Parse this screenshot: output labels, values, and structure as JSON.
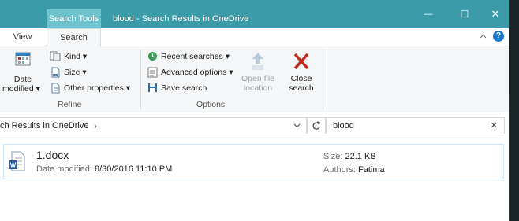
{
  "titlebar": {
    "context_tab": "Search Tools",
    "title": "blood - Search Results in OneDrive",
    "minimize": "—",
    "maximize": "☐",
    "close": "✕"
  },
  "ribbon_tabs": {
    "view": "View",
    "search": "Search"
  },
  "ribbon": {
    "refine": {
      "date_modified_1": "Date",
      "date_modified_2": "modified ▾",
      "kind": "Kind ▾",
      "size": "Size ▾",
      "other_properties": "Other properties ▾",
      "label": "Refine"
    },
    "options": {
      "recent_searches": "Recent searches ▾",
      "advanced_options": "Advanced options ▾",
      "save_search": "Save search",
      "open_file_location_1": "Open file",
      "open_file_location_2": "location",
      "close_search_1": "Close",
      "close_search_2": "search",
      "label": "Options"
    }
  },
  "address": {
    "path": "ch Results in OneDrive",
    "chevron": "›"
  },
  "search": {
    "value": "blood",
    "clear": "✕"
  },
  "file": {
    "name": "1.docx",
    "date_label": "Date modified: ",
    "date_value": "8/30/2016 11:10 PM",
    "size_label": "Size: ",
    "size_value": "22.1 KB",
    "authors_label": "Authors: ",
    "authors_value": "Fatima"
  },
  "colors": {
    "titlebar": "#3c9ba9",
    "context_tab": "#6fc3cf",
    "close_x": "#c42b1c",
    "selection_border": "#cce8ff"
  }
}
